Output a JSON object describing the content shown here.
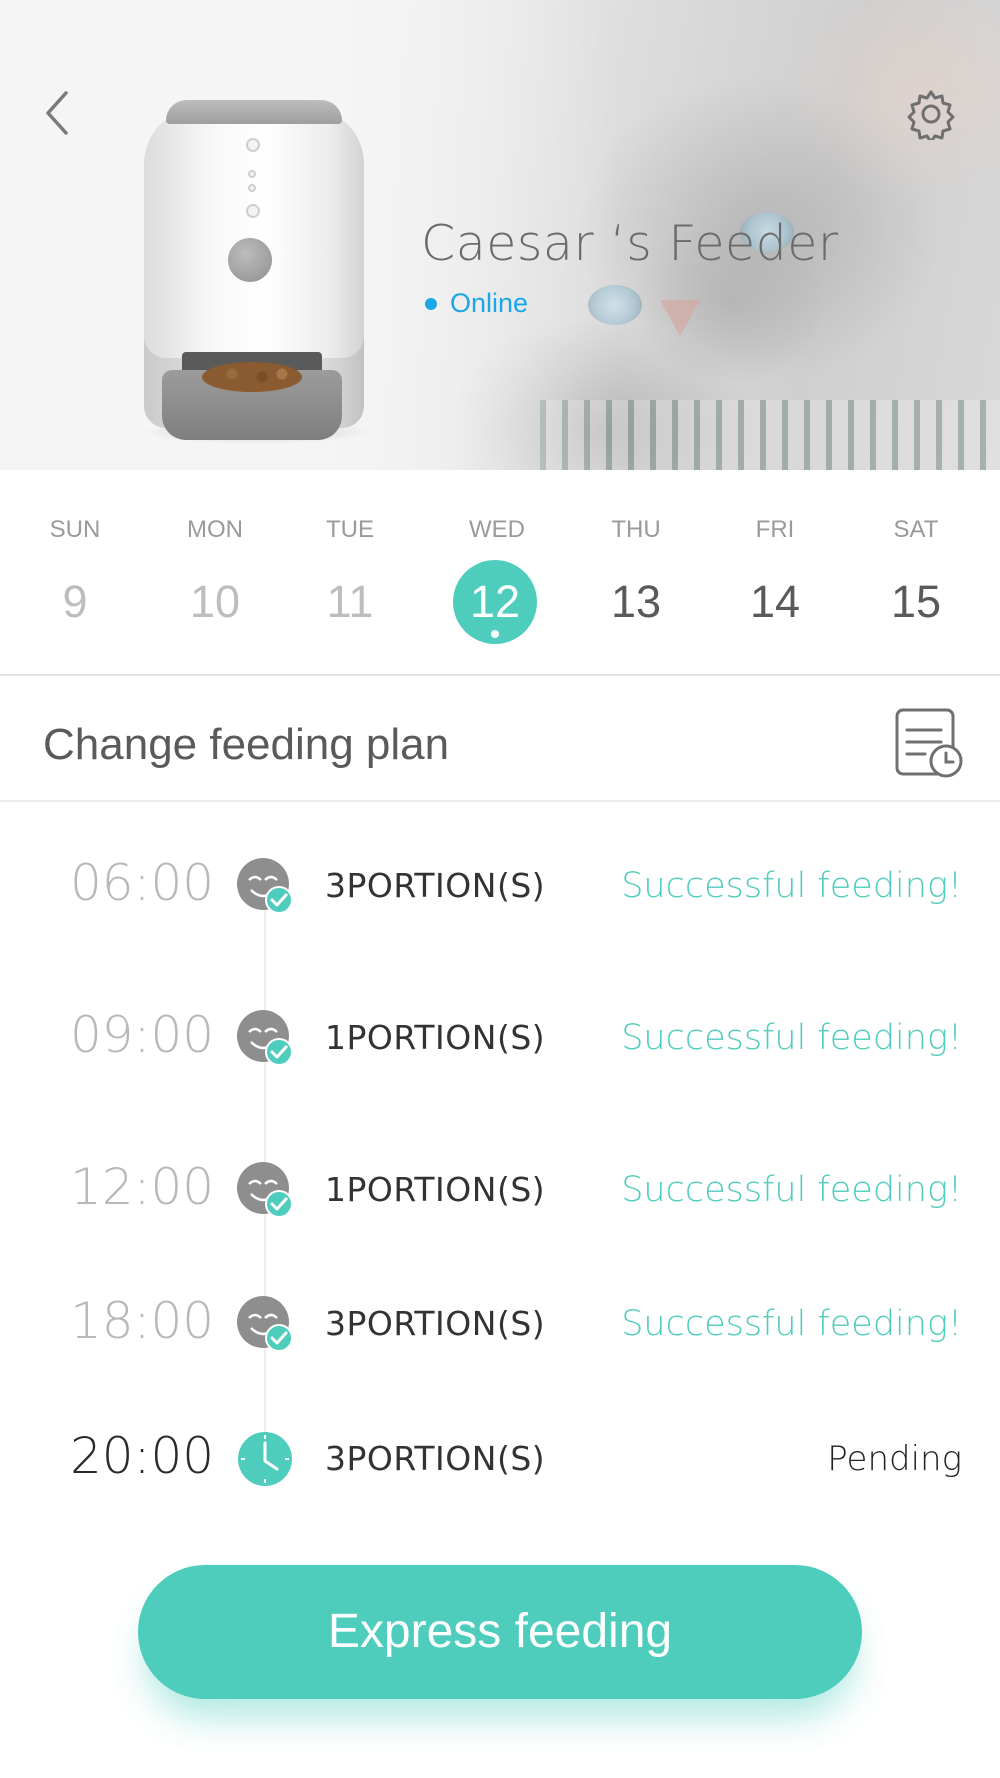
{
  "header": {
    "device_name": "Caesar ‘s Feeder",
    "status": "Online",
    "back_icon": "chevron-left-icon",
    "settings_icon": "gear-icon",
    "status_color": "#1aa6e8"
  },
  "week": {
    "days": [
      {
        "name": "SUN",
        "num": "9",
        "state": "past"
      },
      {
        "name": "MON",
        "num": "10",
        "state": "past"
      },
      {
        "name": "TUE",
        "num": "11",
        "state": "past"
      },
      {
        "name": "WED",
        "num": "12",
        "state": "selected"
      },
      {
        "name": "THU",
        "num": "13",
        "state": "future"
      },
      {
        "name": "FRI",
        "num": "14",
        "state": "future"
      },
      {
        "name": "SAT",
        "num": "15",
        "state": "future"
      }
    ]
  },
  "plan": {
    "label": "Change feeding plan",
    "icon": "schedule-list-icon"
  },
  "feedings": [
    {
      "time": "06:00",
      "portions": "3PORTION(S)",
      "result": "Successful feeding!",
      "status": "done"
    },
    {
      "time": "09:00",
      "portions": "1PORTION(S)",
      "result": "Successful feeding!",
      "status": "done"
    },
    {
      "time": "12:00",
      "portions": "1PORTION(S)",
      "result": "Successful feeding!",
      "status": "done"
    },
    {
      "time": "18:00",
      "portions": "3PORTION(S)",
      "result": "Successful feeding!",
      "status": "done"
    },
    {
      "time": "20:00",
      "portions": "3PORTION(S)",
      "result": "Pending",
      "status": "pending"
    }
  ],
  "express_button": "Express feeding",
  "colors": {
    "accent": "#4ecdbd",
    "online": "#1aa6e8",
    "muted": "#b8b8b8"
  }
}
